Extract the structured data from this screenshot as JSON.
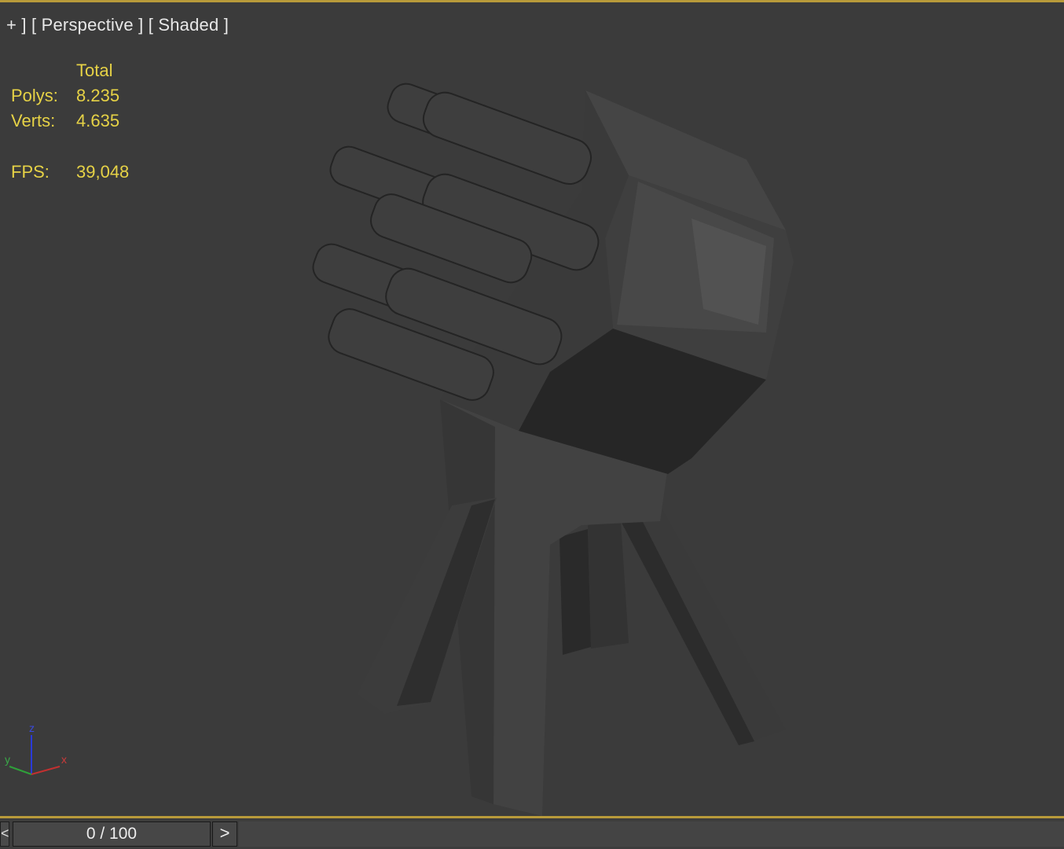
{
  "viewport": {
    "label": {
      "plus": "+ ]",
      "view": " [ Perspective ]",
      "shading": " [ Shaded ]"
    },
    "stats": {
      "header": "Total",
      "polys_label": "Polys:",
      "polys_value": "8.235",
      "verts_label": "Verts:",
      "verts_value": "4.635",
      "fps_label": "FPS:",
      "fps_value": "39,048"
    },
    "axis_gizmo": {
      "z": "z",
      "y": "y",
      "x": "x"
    }
  },
  "timeline": {
    "left_arrow": "<",
    "frame_display": "0 / 100",
    "next_button": ">"
  },
  "colors": {
    "accent_border": "#b89a3a",
    "stats_text": "#e6d246",
    "viewport_bg": "#3b3b3b"
  }
}
